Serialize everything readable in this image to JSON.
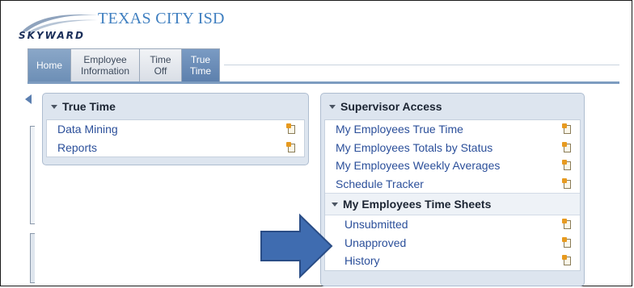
{
  "header": {
    "logo_text": "SKYWARD",
    "district_name": "TEXAS CITY ISD"
  },
  "tabs": [
    {
      "line1": "Home",
      "line2": ""
    },
    {
      "line1": "Employee",
      "line2": "Information"
    },
    {
      "line1": "Time",
      "line2": "Off"
    },
    {
      "line1": "True",
      "line2": "Time"
    }
  ],
  "true_time_panel": {
    "title": "True Time",
    "items": [
      {
        "label": "Data Mining"
      },
      {
        "label": "Reports"
      }
    ]
  },
  "supervisor_panel": {
    "title": "Supervisor Access",
    "items": [
      {
        "label": "My Employees True Time"
      },
      {
        "label": "My Employees Totals by Status"
      },
      {
        "label": "My Employees Weekly Averages"
      },
      {
        "label": "Schedule Tracker"
      }
    ],
    "subsection": {
      "title": "My Employees Time Sheets",
      "items": [
        {
          "label": "Unsubmitted"
        },
        {
          "label": "Unapproved"
        },
        {
          "label": "History"
        }
      ]
    }
  },
  "colors": {
    "link": "#2b4f9a",
    "panel_bg": "#dde5ef",
    "active_tab": "#5d80ad",
    "callout_arrow": "#3f6cb0"
  },
  "icons": {
    "panel_item_icon": "document-icon",
    "left_rail_icon": "triangle-left-icon"
  }
}
